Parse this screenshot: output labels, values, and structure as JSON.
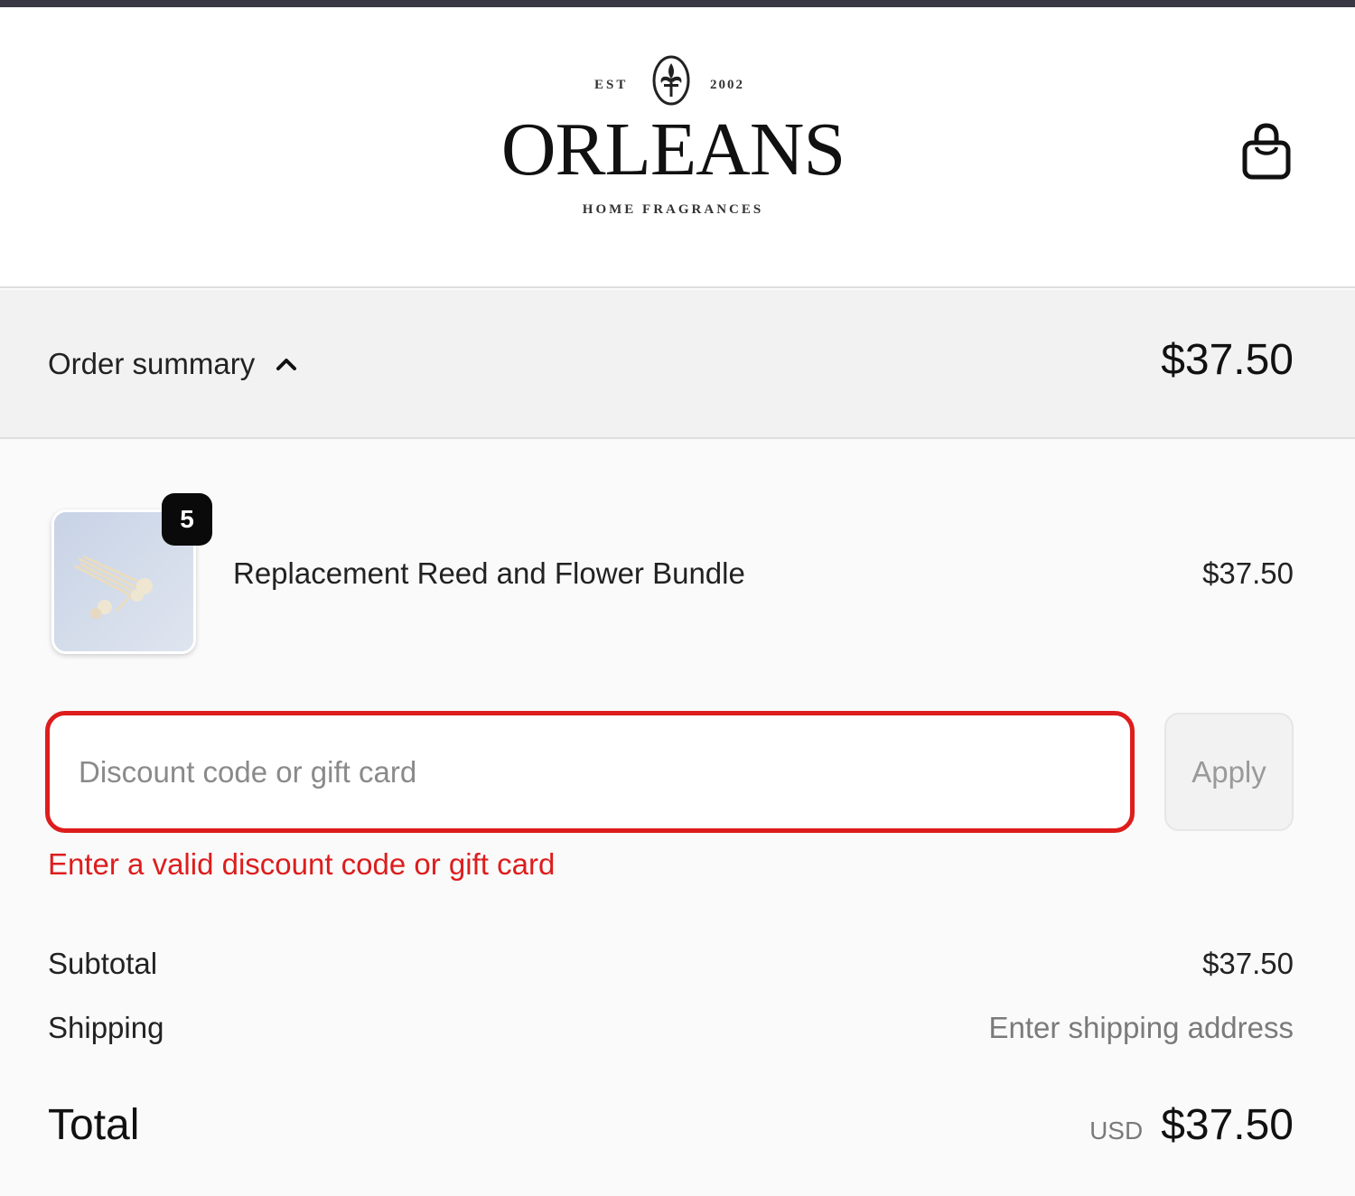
{
  "brand": {
    "est_label": "EST",
    "year": "2002",
    "wordmark": "ORLEANS",
    "tagline": "HOME FRAGRANCES",
    "emblem_icon": "fleur-de-lis-icon"
  },
  "header": {
    "cart_icon": "shopping-bag-icon"
  },
  "summary": {
    "label": "Order summary",
    "toggle_icon": "chevron-up-icon",
    "total": "$37.50"
  },
  "line_item": {
    "quantity": "5",
    "name": "Replacement Reed and Flower Bundle",
    "price": "$37.50"
  },
  "discount": {
    "placeholder": "Discount code or gift card",
    "value": "",
    "apply_label": "Apply",
    "error": "Enter a valid discount code or gift card"
  },
  "totals": {
    "subtotal_label": "Subtotal",
    "subtotal_value": "$37.50",
    "shipping_label": "Shipping",
    "shipping_value": "Enter shipping address",
    "total_label": "Total",
    "currency": "USD",
    "total_value": "$37.50"
  },
  "colors": {
    "error": "#dd1d1d",
    "badge": "#0a0a0a",
    "topbar": "#3a3844"
  }
}
